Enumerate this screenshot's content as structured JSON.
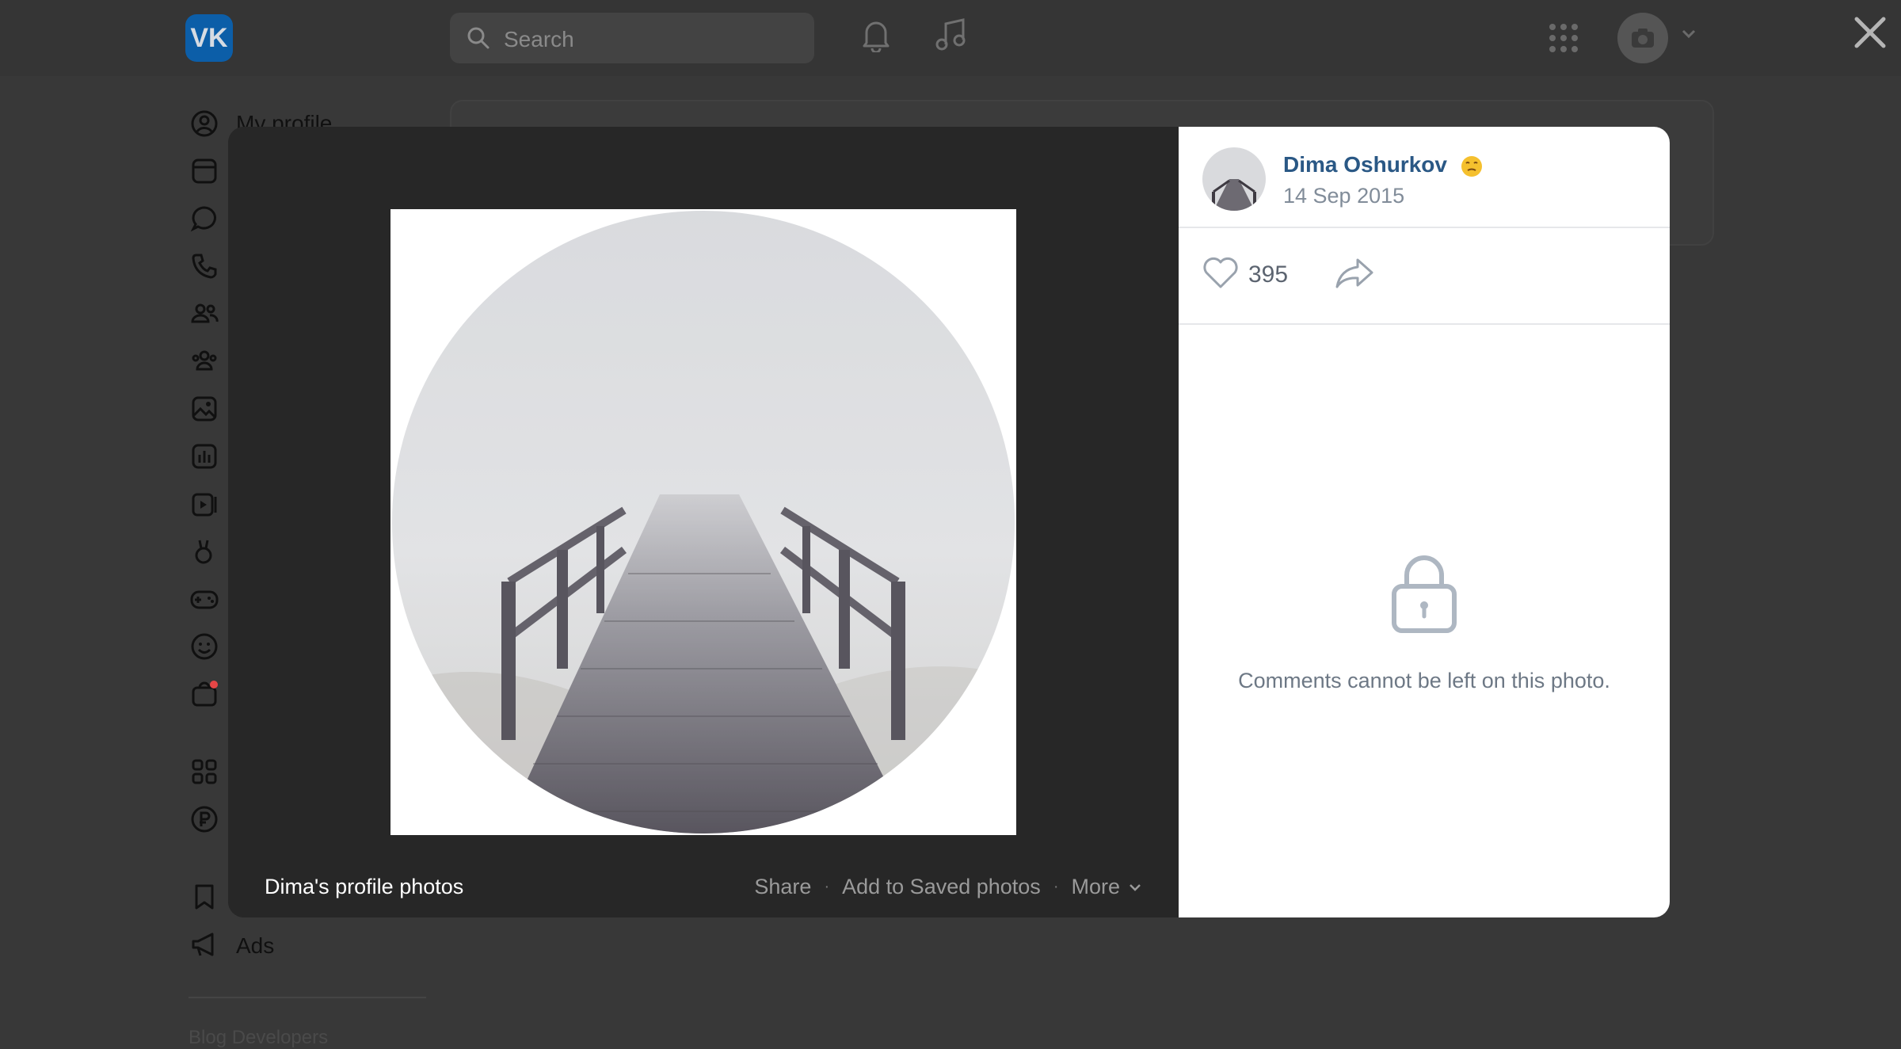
{
  "app": {
    "name": "VK",
    "logo_text": "VK"
  },
  "header": {
    "search_placeholder": "Search"
  },
  "sidebar": {
    "items": [
      {
        "label": "My profile",
        "icon": "user-circle-icon"
      },
      {
        "label": "",
        "icon": "news-icon"
      },
      {
        "label": "",
        "icon": "messages-icon"
      },
      {
        "label": "",
        "icon": "calls-icon"
      },
      {
        "label": "",
        "icon": "friends-icon"
      },
      {
        "label": "",
        "icon": "communities-icon"
      },
      {
        "label": "",
        "icon": "photos-icon"
      },
      {
        "label": "",
        "icon": "music-icon"
      },
      {
        "label": "",
        "icon": "video-icon"
      },
      {
        "label": "",
        "icon": "clips-icon"
      },
      {
        "label": "",
        "icon": "games-icon"
      },
      {
        "label": "",
        "icon": "stickers-icon"
      },
      {
        "label": "",
        "icon": "market-icon"
      },
      {
        "label": "",
        "icon": "services-icon"
      },
      {
        "label": "",
        "icon": "vk-pay-icon"
      },
      {
        "label": "",
        "icon": "bookmarks-icon"
      },
      {
        "label": "Ads",
        "icon": "ads-icon"
      }
    ],
    "footer_links": "Blog   Developers"
  },
  "viewer": {
    "album_title": "Dima's profile photos",
    "actions": {
      "share": "Share",
      "save": "Add to Saved photos",
      "more": "More"
    },
    "author": {
      "name": "Dima Oshurkov",
      "date": "14 Sep 2015"
    },
    "likes": "395",
    "comments_disabled_text": "Comments cannot be left on this photo."
  },
  "colors": {
    "link": "#2a5885",
    "modal_bg": "#272727",
    "panel_bg": "#ffffff"
  }
}
